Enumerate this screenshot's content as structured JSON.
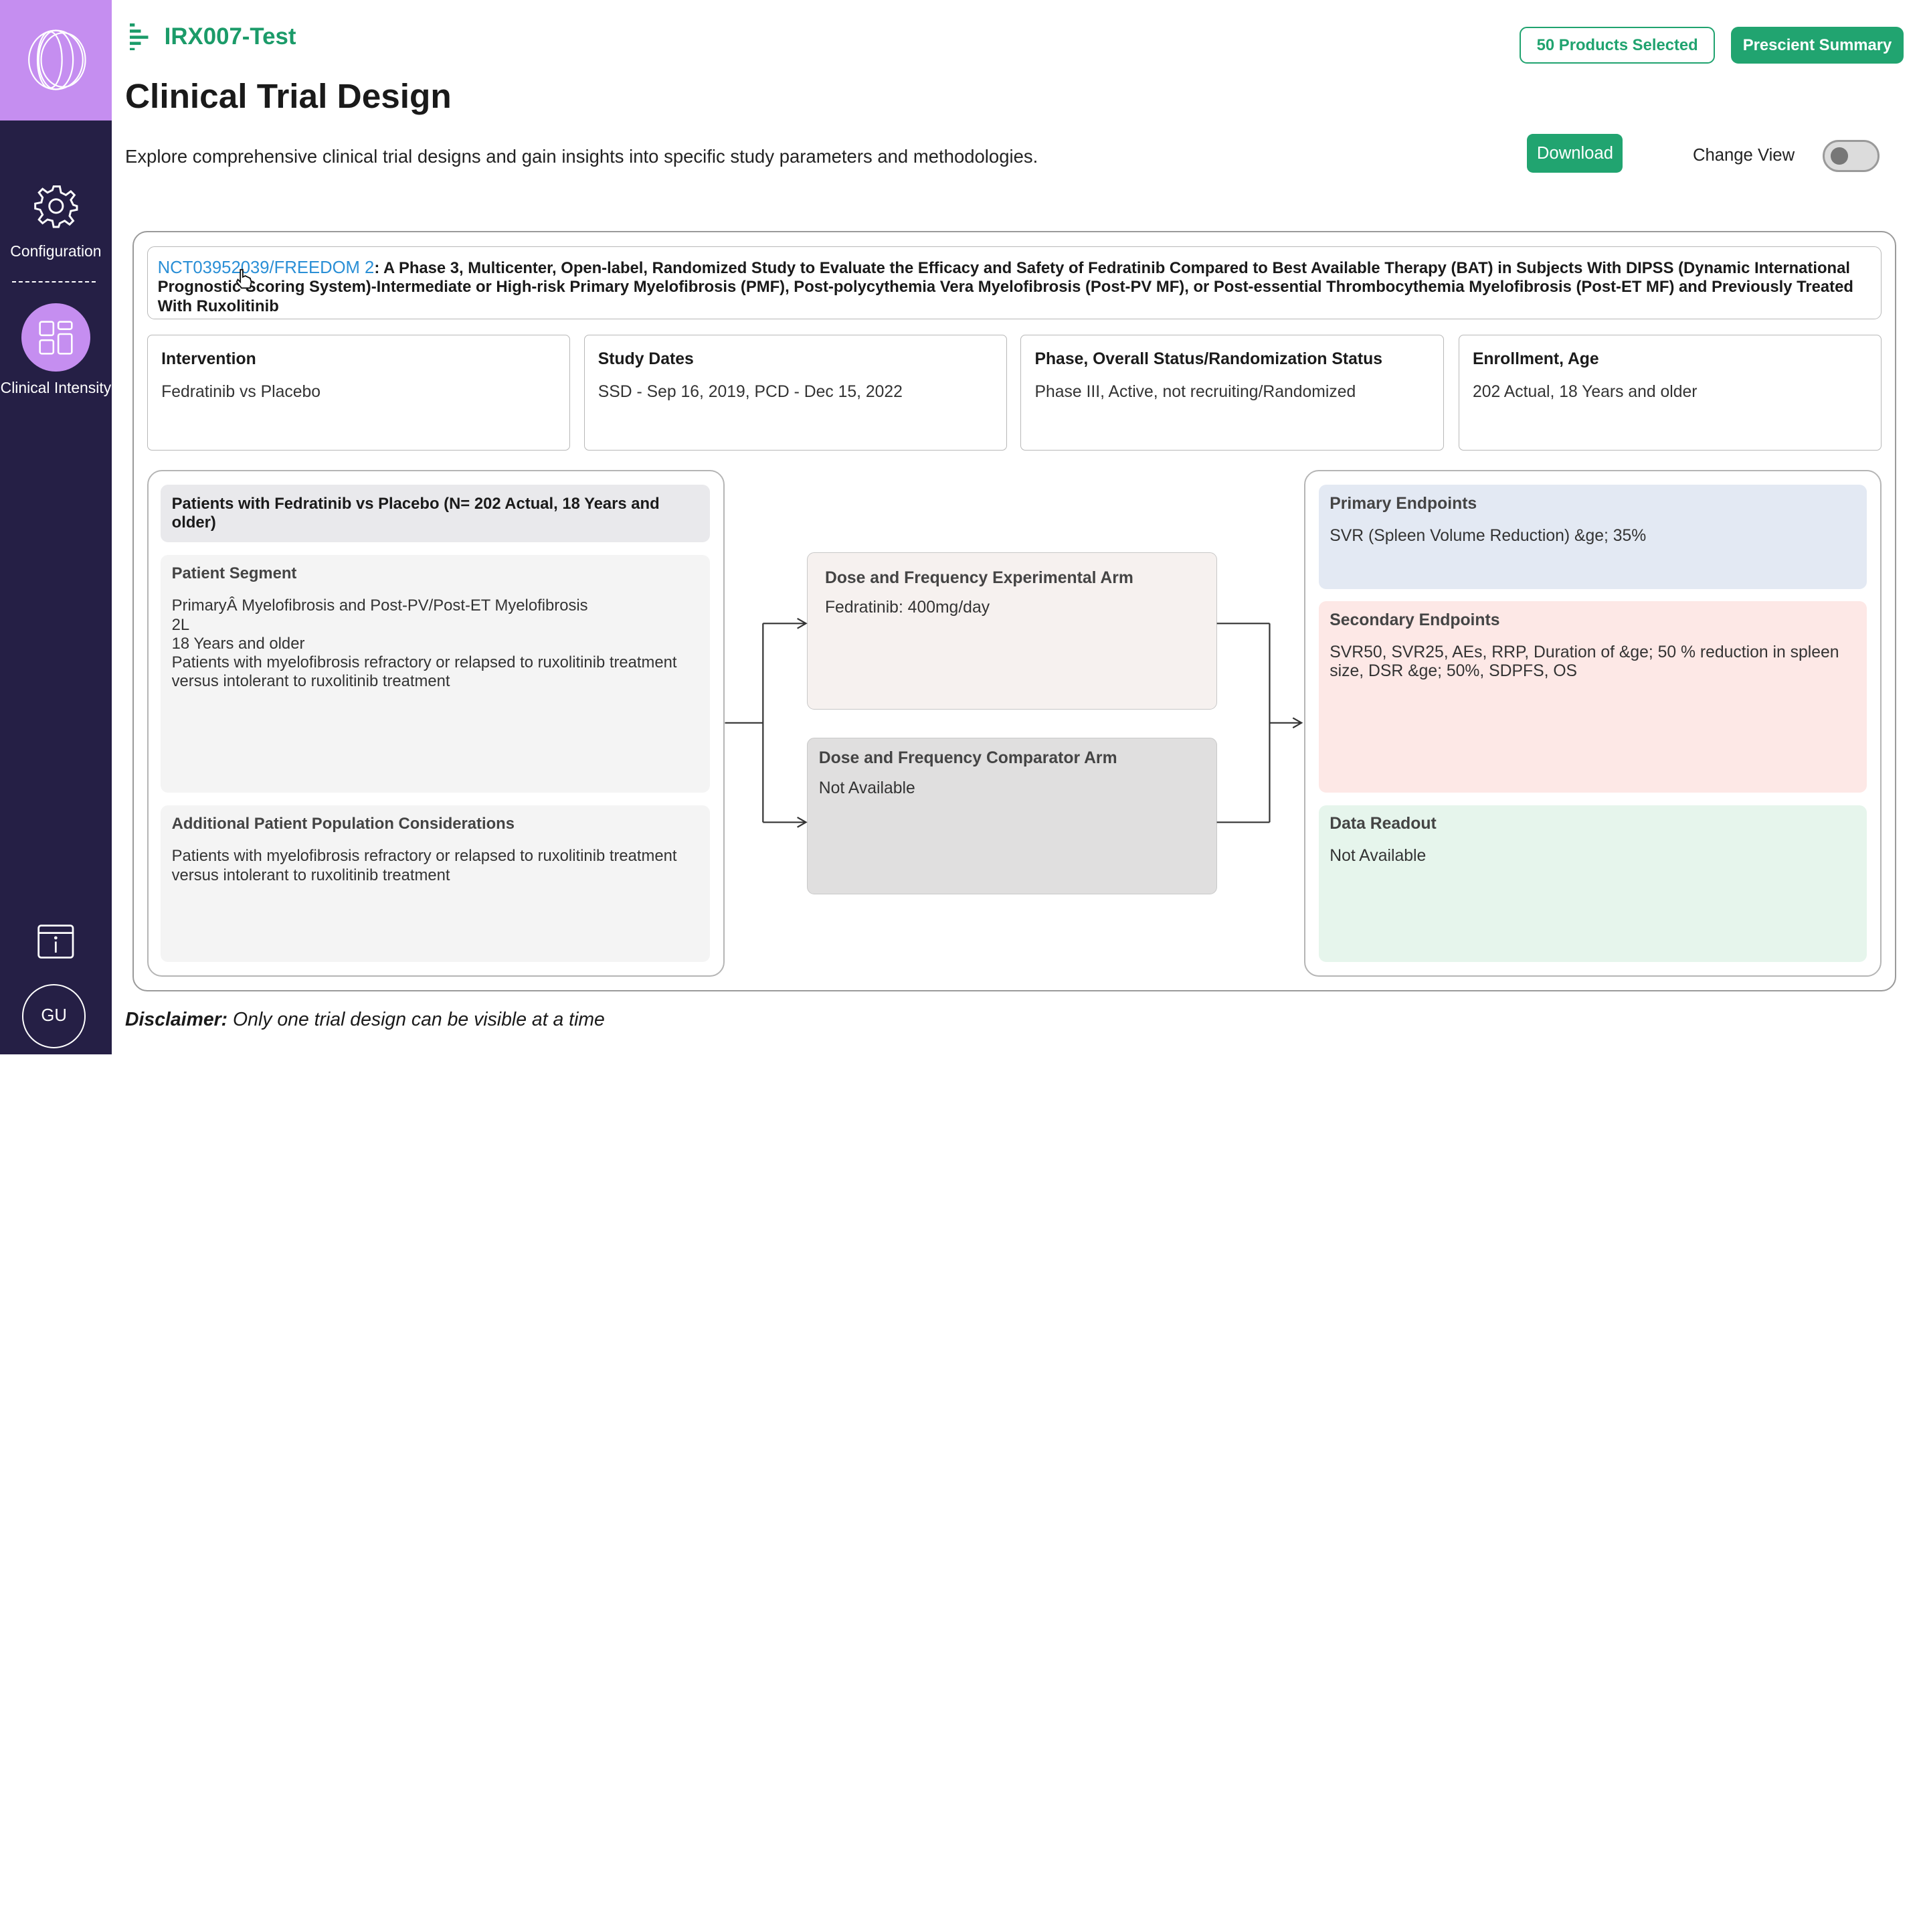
{
  "sidebar": {
    "items": [
      {
        "label": "Configuration",
        "icon": "gear-icon"
      },
      {
        "label": "Clinical Intensity",
        "icon": "dashboard-icon"
      }
    ],
    "info_icon": "info-icon",
    "avatar_initials": "GU"
  },
  "header": {
    "project_name": "IRX007-Test",
    "products_selected": "50 Products Selected",
    "prescient_summary": "Prescient Summary",
    "title": "Clinical Trial Design",
    "description": "Explore comprehensive clinical trial designs and gain insights into specific study parameters and methodologies.",
    "download": "Download",
    "change_view": "Change View"
  },
  "trial": {
    "id_link": "NCT03952039/FREEDOM 2",
    "title": ": A Phase 3, Multicenter, Open-label, Randomized Study to Evaluate the Efficacy and Safety of Fedratinib Compared to Best Available Therapy (BAT) in Subjects With DIPSS (Dynamic International Prognostic Scoring System)-Intermediate or High-risk Primary Myelofibrosis (PMF), Post-polycythemia Vera Myelofibrosis (Post-PV MF), or Post-essential Thrombocythemia Myelofibrosis (Post-ET MF) and Previously Treated With Ruxolitinib"
  },
  "info_cards": [
    {
      "heading": "Intervention",
      "value": "Fedratinib  vs Placebo"
    },
    {
      "heading": "Study Dates",
      "value": "SSD - Sep 16, 2019, PCD - Dec 15, 2022"
    },
    {
      "heading": "Phase, Overall Status/Randomization Status",
      "value": "Phase III, Active, not recruiting/Randomized"
    },
    {
      "heading": "Enrollment, Age",
      "value": "202 Actual, 18 Years and older"
    }
  ],
  "patients": {
    "header": "Patients with Fedratinib  vs Placebo  (N= 202 Actual, 18 Years and older)",
    "segment_heading": "Patient Segment",
    "segment_lines": [
      "PrimaryÂ Myelofibrosis and Post-PV/Post-ET Myelofibrosis",
      "2L",
      "18 Years and older",
      "Patients with myelofibrosis refractory or relapsed to ruxolitinib treatment versus intolerant to ruxolitinib treatment"
    ],
    "additional_heading": "Additional Patient Population Considerations",
    "additional_text": "Patients with myelofibrosis refractory or relapsed to ruxolitinib treatment versus intolerant to ruxolitinib treatment"
  },
  "arms": {
    "experimental_heading": "Dose and Frequency Experimental Arm",
    "experimental_value": "Fedratinib: 400mg/day",
    "comparator_heading": "Dose and Frequency Comparator Arm",
    "comparator_value": "Not Available"
  },
  "endpoints": {
    "primary_heading": "Primary Endpoints",
    "primary_value": "SVR (Spleen Volume Reduction) &ge; 35%",
    "secondary_heading": "Secondary Endpoints",
    "secondary_value": "SVR50, SVR25, AEs, RRP, Duration of &ge; 50 % reduction in spleen size, DSR &ge; 50%, SDPFS, OS",
    "readout_heading": "Data Readout",
    "readout_value": "Not Available"
  },
  "disclaimer": {
    "label": "Disclaimer:",
    "text": "Only one trial design can be visible at a time"
  },
  "colors": {
    "sidebar_bg": "#251f45",
    "accent_purple": "#c58ef0",
    "brand_green": "#21a470",
    "link_blue": "#2a8fd6",
    "primary_bg": "#e3e9f3",
    "secondary_bg": "#fde8e6",
    "readout_bg": "#e6f5ec",
    "experimental_bg": "#f6f1ef",
    "comparator_bg": "#e0dfdf"
  }
}
